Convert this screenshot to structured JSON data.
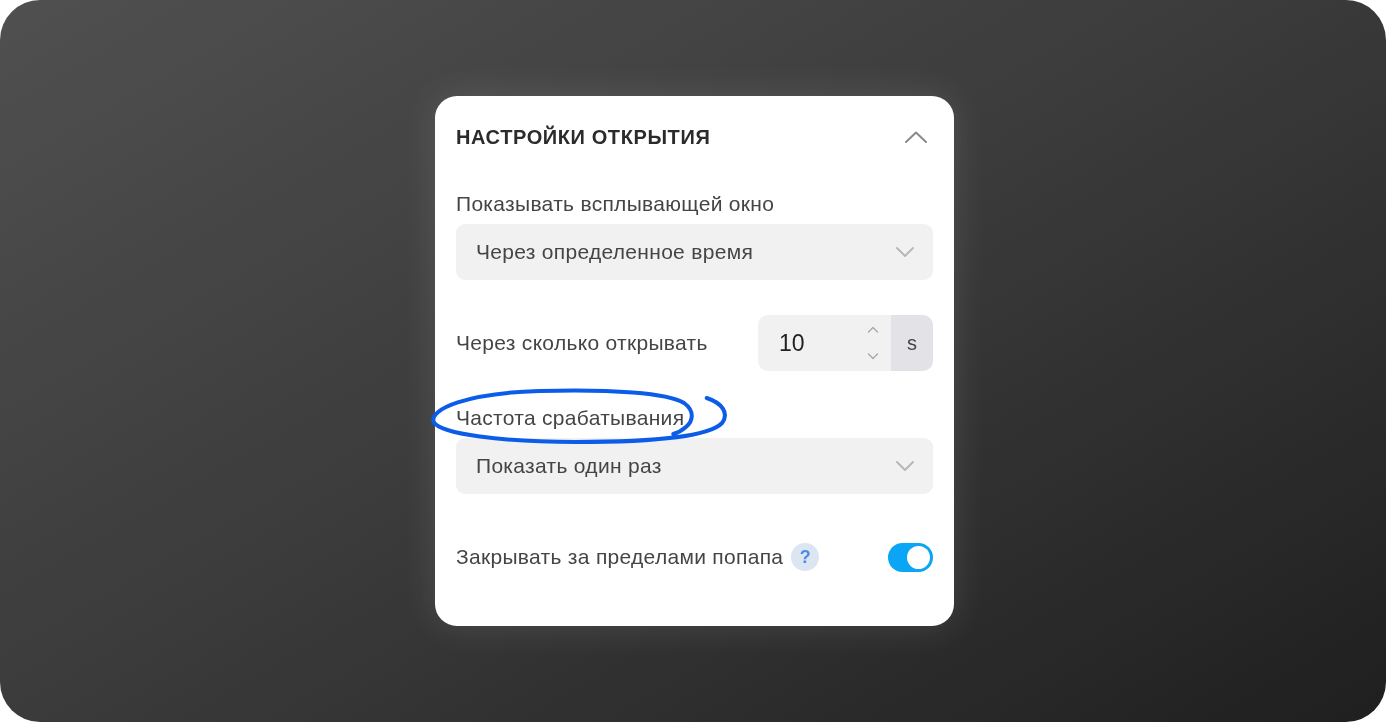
{
  "panel": {
    "title": "НАСТРОЙКИ ОТКРЫТИЯ",
    "expanded": true
  },
  "fields": [
    {
      "kind": "select",
      "label": "Показывать всплывающей окно",
      "value": "Через определенное время",
      "circled": false
    },
    {
      "kind": "number",
      "label": "Через сколько открывать",
      "value": "10",
      "unit": "s",
      "circled": false
    },
    {
      "kind": "select",
      "label": "Частота срабатывания",
      "value": "Показать один раз",
      "circled": true
    },
    {
      "kind": "toggle",
      "label": "Закрывать за пределами попапа",
      "help": "?",
      "on": true,
      "circled": false
    }
  ]
}
